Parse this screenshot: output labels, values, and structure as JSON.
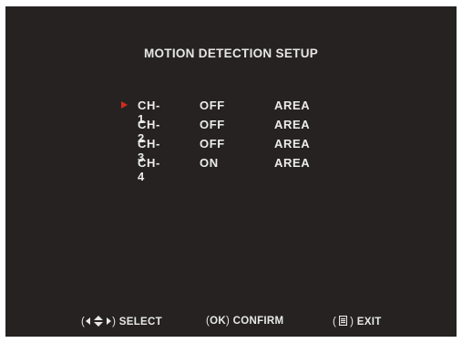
{
  "screen": {
    "title": "MOTION DETECTION SETUP"
  },
  "channels": [
    {
      "channel": "CH-1",
      "state": "OFF",
      "area": "AREA",
      "selected": true
    },
    {
      "channel": "CH-2",
      "state": "OFF",
      "area": "AREA",
      "selected": false
    },
    {
      "channel": "CH-3",
      "state": "OFF",
      "area": "AREA",
      "selected": false
    },
    {
      "channel": "CH-4",
      "state": "ON",
      "area": "AREA",
      "selected": false
    }
  ],
  "footer": {
    "select_label": "SELECT",
    "confirm_key": "OK",
    "confirm_label": "CONFIRM",
    "exit_label": "EXIT"
  },
  "icons": {
    "selection_cursor": "right-triangle-icon",
    "select_key": "four-way-arrows-icon",
    "exit_key": "menu-key-icon"
  },
  "colors": {
    "background": "#262222",
    "text": "#e9e9e9",
    "cursor": "#d52a1e"
  }
}
